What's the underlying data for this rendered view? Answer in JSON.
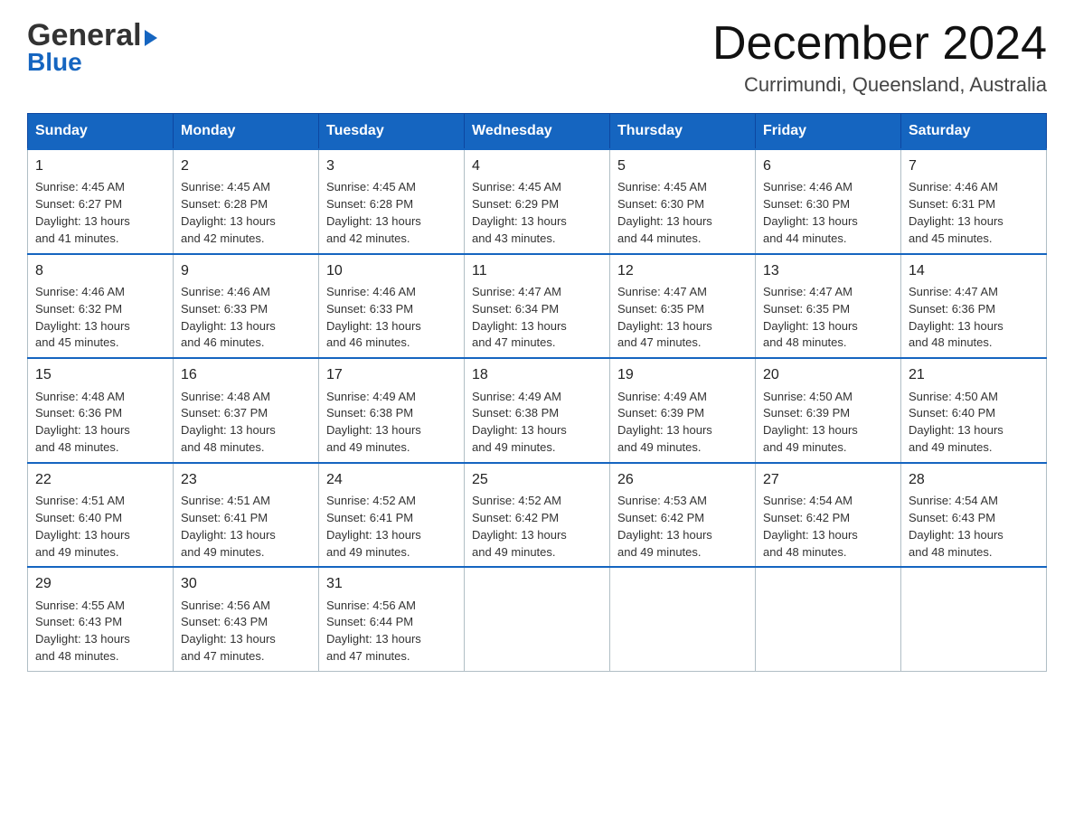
{
  "header": {
    "logo_general": "General",
    "logo_blue": "Blue",
    "month_title": "December 2024",
    "location": "Currimundi, Queensland, Australia"
  },
  "weekdays": [
    "Sunday",
    "Monday",
    "Tuesday",
    "Wednesday",
    "Thursday",
    "Friday",
    "Saturday"
  ],
  "weeks": [
    [
      {
        "day": "1",
        "sunrise": "4:45 AM",
        "sunset": "6:27 PM",
        "daylight": "13 hours and 41 minutes."
      },
      {
        "day": "2",
        "sunrise": "4:45 AM",
        "sunset": "6:28 PM",
        "daylight": "13 hours and 42 minutes."
      },
      {
        "day": "3",
        "sunrise": "4:45 AM",
        "sunset": "6:28 PM",
        "daylight": "13 hours and 42 minutes."
      },
      {
        "day": "4",
        "sunrise": "4:45 AM",
        "sunset": "6:29 PM",
        "daylight": "13 hours and 43 minutes."
      },
      {
        "day": "5",
        "sunrise": "4:45 AM",
        "sunset": "6:30 PM",
        "daylight": "13 hours and 44 minutes."
      },
      {
        "day": "6",
        "sunrise": "4:46 AM",
        "sunset": "6:30 PM",
        "daylight": "13 hours and 44 minutes."
      },
      {
        "day": "7",
        "sunrise": "4:46 AM",
        "sunset": "6:31 PM",
        "daylight": "13 hours and 45 minutes."
      }
    ],
    [
      {
        "day": "8",
        "sunrise": "4:46 AM",
        "sunset": "6:32 PM",
        "daylight": "13 hours and 45 minutes."
      },
      {
        "day": "9",
        "sunrise": "4:46 AM",
        "sunset": "6:33 PM",
        "daylight": "13 hours and 46 minutes."
      },
      {
        "day": "10",
        "sunrise": "4:46 AM",
        "sunset": "6:33 PM",
        "daylight": "13 hours and 46 minutes."
      },
      {
        "day": "11",
        "sunrise": "4:47 AM",
        "sunset": "6:34 PM",
        "daylight": "13 hours and 47 minutes."
      },
      {
        "day": "12",
        "sunrise": "4:47 AM",
        "sunset": "6:35 PM",
        "daylight": "13 hours and 47 minutes."
      },
      {
        "day": "13",
        "sunrise": "4:47 AM",
        "sunset": "6:35 PM",
        "daylight": "13 hours and 48 minutes."
      },
      {
        "day": "14",
        "sunrise": "4:47 AM",
        "sunset": "6:36 PM",
        "daylight": "13 hours and 48 minutes."
      }
    ],
    [
      {
        "day": "15",
        "sunrise": "4:48 AM",
        "sunset": "6:36 PM",
        "daylight": "13 hours and 48 minutes."
      },
      {
        "day": "16",
        "sunrise": "4:48 AM",
        "sunset": "6:37 PM",
        "daylight": "13 hours and 48 minutes."
      },
      {
        "day": "17",
        "sunrise": "4:49 AM",
        "sunset": "6:38 PM",
        "daylight": "13 hours and 49 minutes."
      },
      {
        "day": "18",
        "sunrise": "4:49 AM",
        "sunset": "6:38 PM",
        "daylight": "13 hours and 49 minutes."
      },
      {
        "day": "19",
        "sunrise": "4:49 AM",
        "sunset": "6:39 PM",
        "daylight": "13 hours and 49 minutes."
      },
      {
        "day": "20",
        "sunrise": "4:50 AM",
        "sunset": "6:39 PM",
        "daylight": "13 hours and 49 minutes."
      },
      {
        "day": "21",
        "sunrise": "4:50 AM",
        "sunset": "6:40 PM",
        "daylight": "13 hours and 49 minutes."
      }
    ],
    [
      {
        "day": "22",
        "sunrise": "4:51 AM",
        "sunset": "6:40 PM",
        "daylight": "13 hours and 49 minutes."
      },
      {
        "day": "23",
        "sunrise": "4:51 AM",
        "sunset": "6:41 PM",
        "daylight": "13 hours and 49 minutes."
      },
      {
        "day": "24",
        "sunrise": "4:52 AM",
        "sunset": "6:41 PM",
        "daylight": "13 hours and 49 minutes."
      },
      {
        "day": "25",
        "sunrise": "4:52 AM",
        "sunset": "6:42 PM",
        "daylight": "13 hours and 49 minutes."
      },
      {
        "day": "26",
        "sunrise": "4:53 AM",
        "sunset": "6:42 PM",
        "daylight": "13 hours and 49 minutes."
      },
      {
        "day": "27",
        "sunrise": "4:54 AM",
        "sunset": "6:42 PM",
        "daylight": "13 hours and 48 minutes."
      },
      {
        "day": "28",
        "sunrise": "4:54 AM",
        "sunset": "6:43 PM",
        "daylight": "13 hours and 48 minutes."
      }
    ],
    [
      {
        "day": "29",
        "sunrise": "4:55 AM",
        "sunset": "6:43 PM",
        "daylight": "13 hours and 48 minutes."
      },
      {
        "day": "30",
        "sunrise": "4:56 AM",
        "sunset": "6:43 PM",
        "daylight": "13 hours and 47 minutes."
      },
      {
        "day": "31",
        "sunrise": "4:56 AM",
        "sunset": "6:44 PM",
        "daylight": "13 hours and 47 minutes."
      },
      null,
      null,
      null,
      null
    ]
  ],
  "labels": {
    "sunrise": "Sunrise:",
    "sunset": "Sunset:",
    "daylight": "Daylight:"
  }
}
